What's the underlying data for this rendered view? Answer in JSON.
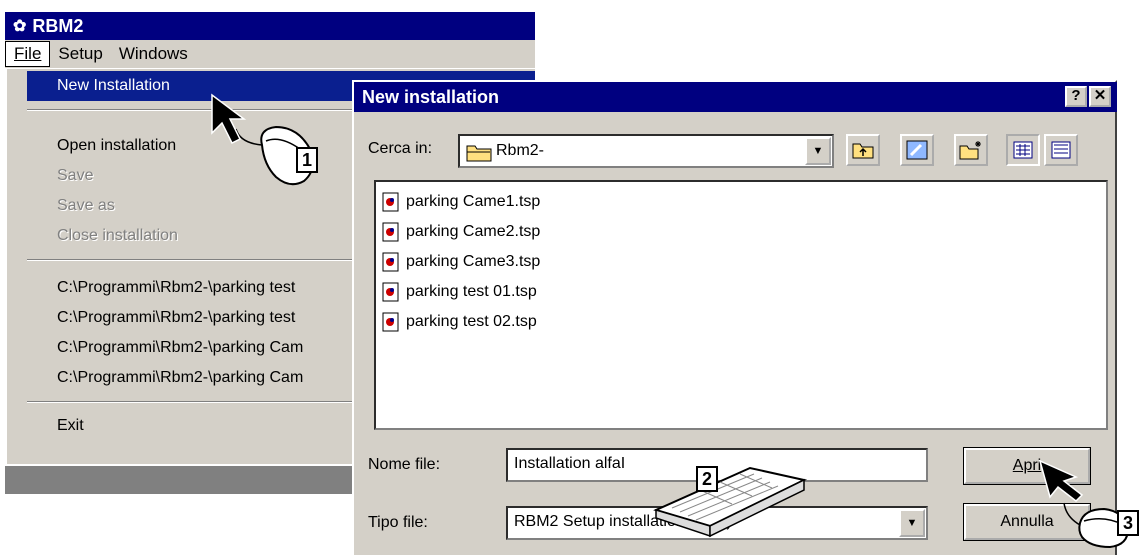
{
  "app": {
    "title": "RBM2",
    "menubar": [
      "File",
      "Setup",
      "Windows"
    ],
    "file_menu": {
      "new_installation": "New Installation",
      "open_installation": "Open installation",
      "save": "Save",
      "save_as": "Save as",
      "close_installation": "Close installation",
      "recent": [
        "C:\\Programmi\\Rbm2-\\parking test",
        "C:\\Programmi\\Rbm2-\\parking test",
        "C:\\Programmi\\Rbm2-\\parking Cam",
        "C:\\Programmi\\Rbm2-\\parking Cam"
      ],
      "exit": "Exit"
    }
  },
  "dialog": {
    "title": "New installation",
    "help_label": "?",
    "close_label": "✕",
    "look_in_label": "Cerca in:",
    "look_in_value": "Rbm2-",
    "files": [
      "parking Came1.tsp",
      "parking Came2.tsp",
      "parking Came3.tsp",
      "parking test 01.tsp",
      "parking test 02.tsp"
    ],
    "filename_label": "Nome file:",
    "filename_value": "Installation alfa",
    "filetype_label": "Tipo file:",
    "filetype_value": "RBM2 Setup installation (*.tsp)",
    "open_button": "Apri",
    "cancel_button": "Annulla"
  },
  "callouts": [
    "1",
    "2",
    "3"
  ]
}
